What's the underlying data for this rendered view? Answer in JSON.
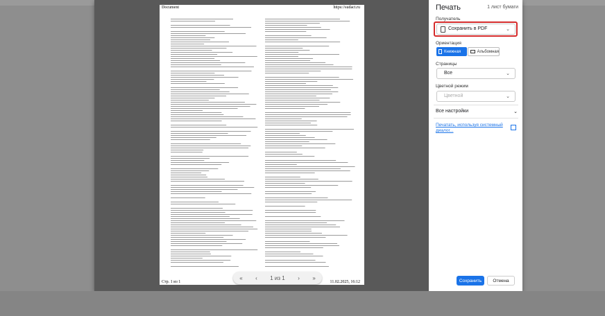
{
  "preview": {
    "header_left": "Document",
    "header_right": "https://sudact.ru",
    "footer_left": "Стр. 1 из 1",
    "footer_right": "11.02.2025, 16:12",
    "pager": {
      "first": "«",
      "prev": "‹",
      "page_label": "1 из 1",
      "next": "›",
      "last": "»"
    }
  },
  "panel": {
    "title": "Печать",
    "sheets": "1 лист бумаги",
    "destination_label": "Получатель",
    "destination_value": "Сохранить в PDF",
    "layout_label": "Ориентация",
    "portrait": "Книжная",
    "landscape": "Альбомная",
    "pages_label": "Страницы",
    "pages_value": "Все",
    "color_label": "Цветной режим",
    "color_value": "Цветной",
    "more_settings": "Все настройки",
    "system_dialog": "Печатать, используя системный диалог...",
    "save_button": "Сохранить",
    "cancel_button": "Отмена"
  },
  "colors": {
    "accent": "#1a73e8",
    "highlight": "#d52b2b",
    "backdrop": "#8e8e8e",
    "preview_bg": "#595959"
  }
}
